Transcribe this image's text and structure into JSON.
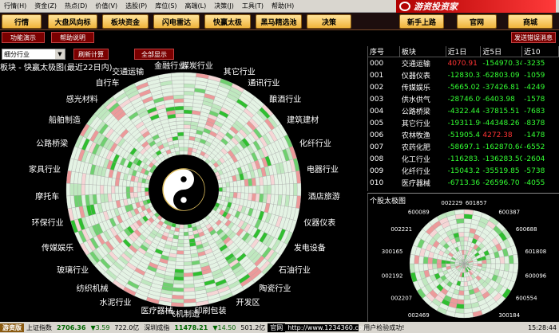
{
  "menu": [
    "行情(H)",
    "资金(Z)",
    "热点(D)",
    "价值(V)",
    "选股(P)",
    "库位(S)",
    "高端(L)",
    "决策(J)",
    "工具(T)",
    "帮助(H)"
  ],
  "logo_text": "游资投资家",
  "toolbar": {
    "buttons": [
      "行情",
      "大盘风向标",
      "板块资金",
      "闪电雷达",
      "快赢太极",
      "黑马精选池",
      "决策"
    ],
    "right_buttons": [
      "新手上路",
      "官网",
      "商城"
    ]
  },
  "subbar": {
    "left": [
      "功能演示",
      "帮助说明"
    ],
    "right": "发送错误消息"
  },
  "controls": {
    "select_value": "细分行业",
    "refresh_label": "刷新计算",
    "fullscreen_label": "全部显示"
  },
  "panel_title": "板块 - 快赢太极图(最近22日内)",
  "chart_data": {
    "type": "radial-heatmap",
    "title": "板块 - 快赢太极图(最近22日内)",
    "rings": 22,
    "sectors": [
      "煤炭行业",
      "其它行业",
      "通讯行业",
      "酿酒行业",
      "建筑建材",
      "化纤行业",
      "电器行业",
      "酒店旅游",
      "仪器仪表",
      "发电设备",
      "石油行业",
      "陶瓷行业",
      "开发区",
      "印刷包装",
      "飞机制造",
      "医疗器械",
      "水泥行业",
      "纺织机械",
      "玻璃行业",
      "传媒娱乐",
      "环保行业",
      "摩托车",
      "家具行业",
      "公路桥梁",
      "船舶制造",
      "感光材料",
      "自行车",
      "交通运输",
      "金融行业"
    ]
  },
  "table": {
    "headers": [
      "序号",
      "板块",
      "近1日",
      "近5日",
      "近10"
    ],
    "rows": [
      [
        "000",
        "交通运输",
        "4070.91",
        "-154970.34",
        "-3235"
      ],
      [
        "001",
        "仪器仪表",
        "-12830.32",
        "-62803.09",
        "-1059"
      ],
      [
        "002",
        "传媒娱乐",
        "-5665.02",
        "-37426.81",
        "-4249"
      ],
      [
        "003",
        "供水供气",
        "-28746.09",
        "-6403.98",
        "-1578"
      ],
      [
        "004",
        "公路桥梁",
        "-4322.44",
        "-37815.51",
        "-7683"
      ],
      [
        "005",
        "其它行业",
        "-19311.90",
        "-44348.26",
        "-8378"
      ],
      [
        "006",
        "农林牧渔",
        "-51905.47",
        "4272.38",
        "-1478"
      ],
      [
        "007",
        "农药化肥",
        "-58697.11",
        "-162870.64",
        "-6552"
      ],
      [
        "008",
        "化工行业",
        "-116283.10",
        "-136283.50",
        "-2604"
      ],
      [
        "009",
        "化纤行业",
        "-15043.21",
        "-35519.85",
        "-5738"
      ],
      [
        "010",
        "医疗器械",
        "-6713.36",
        "-26596.70",
        "-4055"
      ]
    ]
  },
  "mini_chart": {
    "title": "个股太极图",
    "labels": [
      "601857",
      "600387",
      "600688",
      "601808",
      "600096",
      "600554",
      "300184",
      "002224",
      "002377",
      "002469",
      "002207",
      "002192",
      "300165",
      "002221",
      "600089",
      "002229"
    ]
  },
  "status": {
    "app": "游资版",
    "index_name": "上证指数",
    "index_value": "2706.36",
    "index_change": "▼3.59",
    "index_amount": "722.0亿",
    "sz_name": "深圳成指",
    "sz_value": "11478.21",
    "sz_change": "▼14.50",
    "sz_amount": "501.2亿",
    "url_label": "官网",
    "url": "http://www.1234360.com",
    "message": "用户检验成功!",
    "time": "15:28:44"
  }
}
